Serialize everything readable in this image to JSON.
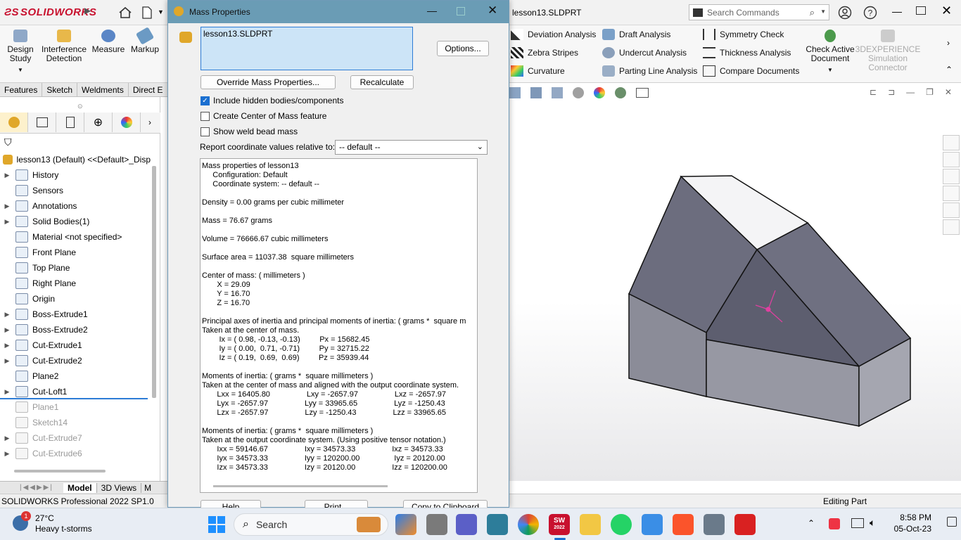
{
  "app": {
    "logo_text": "SOLIDWORKS",
    "window_title": "lesson13.SLDPRT",
    "search_placeholder": "Search Commands"
  },
  "ribbon": {
    "left_buttons": [
      {
        "label": "Design Study"
      },
      {
        "label": "Interference Detection"
      },
      {
        "label": "Measure"
      },
      {
        "label": "Markup"
      }
    ],
    "col1": [
      "Deviation Analysis",
      "Zebra Stripes",
      "Curvature"
    ],
    "col2": [
      "Draft Analysis",
      "Undercut Analysis",
      "Parting Line Analysis"
    ],
    "col3": [
      "Symmetry Check",
      "Thickness Analysis",
      "Compare Documents"
    ],
    "check_active": "Check Active Document",
    "experience": "3DEXPERIENCE Simulation Connector"
  },
  "tabs": [
    "Features",
    "Sketch",
    "Weldments",
    "Direct E"
  ],
  "tree": {
    "root": "lesson13 (Default) <<Default>_Disp",
    "items": [
      {
        "label": "History",
        "arrow": true,
        "dim": false
      },
      {
        "label": "Sensors",
        "arrow": false,
        "dim": false
      },
      {
        "label": "Annotations",
        "arrow": true,
        "dim": false
      },
      {
        "label": "Solid Bodies(1)",
        "arrow": true,
        "dim": false
      },
      {
        "label": "Material <not specified>",
        "arrow": false,
        "dim": false
      },
      {
        "label": "Front Plane",
        "arrow": false,
        "dim": false
      },
      {
        "label": "Top Plane",
        "arrow": false,
        "dim": false
      },
      {
        "label": "Right Plane",
        "arrow": false,
        "dim": false
      },
      {
        "label": "Origin",
        "arrow": false,
        "dim": false
      },
      {
        "label": "Boss-Extrude1",
        "arrow": true,
        "dim": false
      },
      {
        "label": "Boss-Extrude2",
        "arrow": true,
        "dim": false
      },
      {
        "label": "Cut-Extrude1",
        "arrow": true,
        "dim": false
      },
      {
        "label": "Cut-Extrude2",
        "arrow": true,
        "dim": false
      },
      {
        "label": "Plane2",
        "arrow": false,
        "dim": false
      },
      {
        "label": "Cut-Loft1",
        "arrow": true,
        "dim": false
      },
      {
        "label": "Plane1",
        "arrow": false,
        "dim": true
      },
      {
        "label": "Sketch14",
        "arrow": false,
        "dim": true
      },
      {
        "label": "Cut-Extrude7",
        "arrow": true,
        "dim": true
      },
      {
        "label": "Cut-Extrude6",
        "arrow": true,
        "dim": true
      }
    ]
  },
  "bottom_tabs": [
    "Model",
    "3D Views",
    "M"
  ],
  "status": {
    "left": "SOLIDWORKS Professional 2022 SP1.0",
    "right": "Editing Part"
  },
  "dialog": {
    "title": "Mass Properties",
    "selection": "lesson13.SLDPRT",
    "options_btn": "Options...",
    "override_btn": "Override Mass Properties...",
    "recalc_btn": "Recalculate",
    "chk_hidden": "Include hidden bodies/components",
    "chk_com": "Create Center of Mass feature",
    "chk_weld": "Show weld bead mass",
    "report_label": "Report coordinate values relative to:",
    "report_value": "-- default --",
    "help_btn": "Help",
    "print_btn": "Print...",
    "copy_btn": "Copy to Clipboard",
    "results": [
      "Mass properties of lesson13",
      "     Configuration: Default",
      "     Coordinate system: -- default --",
      "",
      "Density = 0.00 grams per cubic millimeter",
      "",
      "Mass = 76.67 grams",
      "",
      "Volume = 76666.67 cubic millimeters",
      "",
      "Surface area = 11037.38  square millimeters",
      "",
      "Center of mass: ( millimeters )",
      "       X = 29.09",
      "       Y = 16.70",
      "       Z = 16.70",
      "",
      "Principal axes of inertia and principal moments of inertia: ( grams *  square m",
      "Taken at the center of mass.",
      "        Ix = ( 0.98, -0.13, -0.13)         Px = 15682.45",
      "        Iy = ( 0.00,  0.71, -0.71)         Py = 32715.22",
      "        Iz = ( 0.19,  0.69,  0.69)         Pz = 35939.44",
      "",
      "Moments of inertia: ( grams *  square millimeters )",
      "Taken at the center of mass and aligned with the output coordinate system.",
      "       Lxx = 16405.80                 Lxy = -2657.97                 Lxz = -2657.97",
      "       Lyx = -2657.97                 Lyy = 33965.65                 Lyz = -1250.43",
      "       Lzx = -2657.97                 Lzy = -1250.43                 Lzz = 33965.65",
      "",
      "Moments of inertia: ( grams *  square millimeters )",
      "Taken at the output coordinate system. (Using positive tensor notation.)",
      "       Ixx = 59146.67                 Ixy = 34573.33                 Ixz = 34573.33",
      "       Iyx = 34573.33                 Iyy = 120200.00                Iyz = 20120.00",
      "       Izx = 34573.33                 Izy = 20120.00                 Izz = 120200.00"
    ]
  },
  "taskbar": {
    "weather_temp": "27°C",
    "weather_desc": "Heavy t-storms",
    "search_label": "Search",
    "time": "8:58 PM",
    "date": "05-Oct-23",
    "notif_badge": "1",
    "sw_badge": "2022"
  }
}
